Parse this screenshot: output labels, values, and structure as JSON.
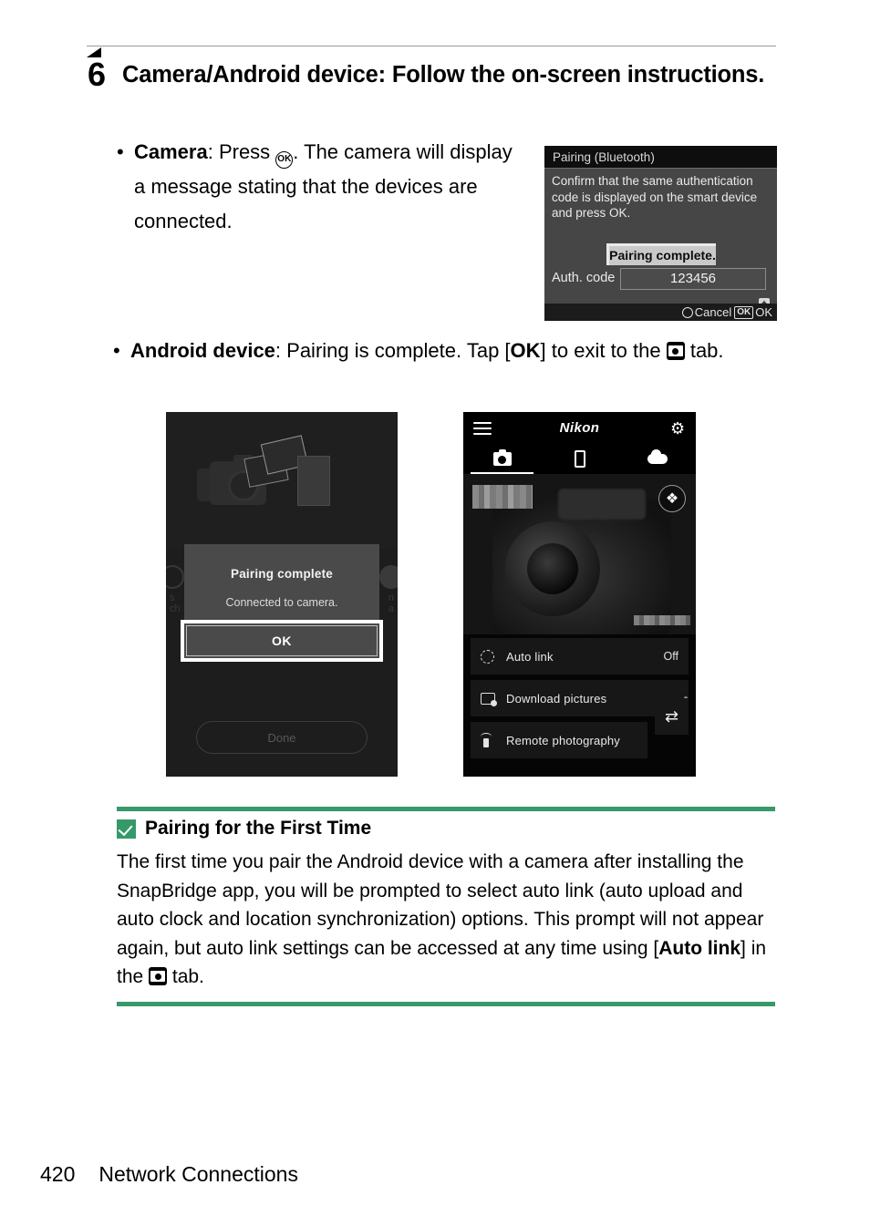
{
  "step": {
    "number": "6",
    "title": "Camera/Android device: Follow the on-screen instructions."
  },
  "bullets": {
    "camera": {
      "marker": "•",
      "label": "Camera",
      "text_before_icon": ": Press ",
      "icon": "ok-button-glyph",
      "text_after_icon": ". The camera will display a message stating that the devices are connected."
    },
    "android": {
      "marker": "•",
      "label": "Android device",
      "text_before_bold": ": Pairing is complete. Tap [",
      "bold": "OK",
      "text_mid": "] to exit to the ",
      "icon": "camera-tab-glyph",
      "text_after": " tab."
    }
  },
  "camera_screen": {
    "title": "Pairing (Bluetooth)",
    "message": "Confirm that the same authentication code is displayed on the smart device and press OK.",
    "status_banner": "Pairing complete.",
    "auth_label": "Auth. code",
    "auth_code": "123456",
    "bluetooth_icon": "bluetooth-icon",
    "footer": {
      "cancel_label": "Cancel",
      "ok_box": "OK",
      "ok_label": "OK"
    }
  },
  "phone_left": {
    "dialog": {
      "title": "Pairing complete",
      "message": "Connected to camera.",
      "primary_button": "OK"
    },
    "done_button": "Done"
  },
  "phone_right": {
    "app_bar": {
      "menu_icon": "hamburger-menu-icon",
      "brand": "Nikon",
      "settings_icon": "gear-icon"
    },
    "tabs": [
      {
        "name": "camera-tab",
        "icon": "camera-icon",
        "active": true
      },
      {
        "name": "device-tab",
        "icon": "smartphone-icon",
        "active": false
      },
      {
        "name": "cloud-tab",
        "icon": "cloud-icon",
        "active": false
      }
    ],
    "bluetooth_badge": "bluetooth-icon",
    "menu_items": [
      {
        "icon": "auto-link-icon",
        "label": "Auto link",
        "value": "Off"
      },
      {
        "icon": "download-pictures-icon",
        "label": "Download pictures",
        "value": ""
      },
      {
        "icon": "remote-photography-icon",
        "label": "Remote photography",
        "value": ""
      }
    ],
    "swap_icon": "swap-arrows-icon"
  },
  "note": {
    "icon": "checkbox-note-icon",
    "title": "Pairing for the First Time",
    "body_part1": "The first time you pair the Android device with a camera after installing the SnapBridge app, you will be prompted to select auto link (auto upload and auto clock and location synchronization) options. This prompt will not appear again, but auto link settings can be accessed at any time using [",
    "body_bold": "Auto link",
    "body_part2": "] in the ",
    "body_part3": " tab."
  },
  "footer": {
    "page_number": "420",
    "section_title": "Network Connections"
  },
  "colors": {
    "note_green": "#35996a",
    "rule_gray": "#9a9a9a",
    "text": "#000000"
  }
}
